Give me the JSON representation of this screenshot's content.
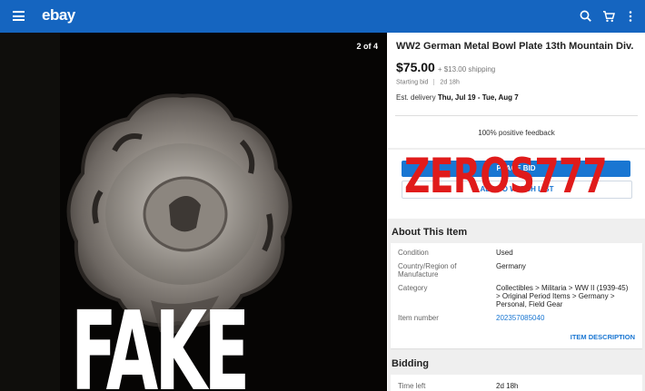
{
  "header": {
    "logo": "ebay",
    "icons": [
      "menu-icon",
      "search-icon",
      "cart-icon",
      "more-vert-icon"
    ]
  },
  "gallery": {
    "counter": "2 of 4",
    "overlay": "FAKE"
  },
  "listing": {
    "title": "WW2 German Metal Bowl Plate 13th Mountain Div.",
    "price": "$75.00",
    "shipping": "+ $13.00 shipping",
    "price_label": "Starting bid",
    "time_left": "2d 18h",
    "delivery_prefix": "Est. delivery",
    "delivery_dates": "Thu, Jul 19 - Tue, Aug 7",
    "feedback": "100% positive feedback",
    "primary_button": "PLACE BID",
    "secondary_button": "ADD TO WATCH LIST",
    "watermark": "ZEROS777"
  },
  "about": {
    "heading": "About This Item",
    "rows": [
      {
        "key": "Condition",
        "value": "Used"
      },
      {
        "key": "Country/Region of Manufacture",
        "value": "Germany"
      },
      {
        "key": "Category",
        "value": "Collectibles > Militaria > WW II (1939-45) > Original Period Items > Germany > Personal, Field Gear"
      },
      {
        "key": "Item number",
        "value": "202357085040"
      }
    ],
    "link": "ITEM DESCRIPTION"
  },
  "bidding": {
    "heading": "Bidding",
    "row_key": "Time left",
    "row_value": "2d 18h"
  },
  "colors": {
    "header": "#1565c0",
    "link": "#1976d2",
    "overlay": "#e01b1b"
  }
}
